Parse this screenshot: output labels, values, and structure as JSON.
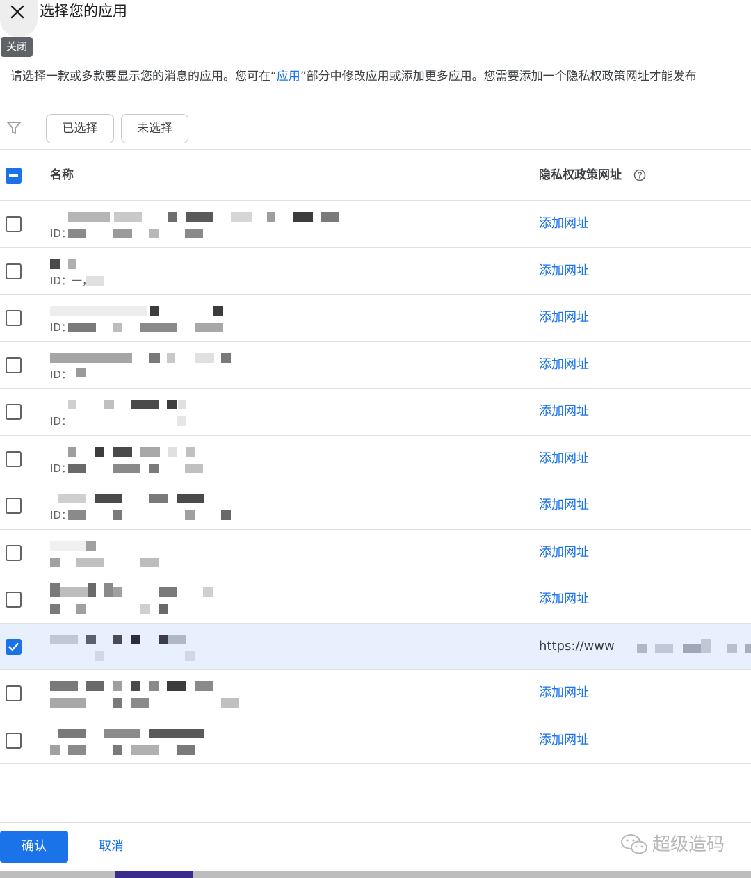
{
  "header": {
    "title": "选择您的应用",
    "close_tooltip": "关闭"
  },
  "description": {
    "before": "请选择一款或多款要显示您的消息的应用。您可在“",
    "link": "应用",
    "after": "”部分中修改应用或添加更多应用。您需要添加一个隐私权政策网址才能发布"
  },
  "filters": {
    "selected_label": "已选择",
    "unselected_label": "未选择"
  },
  "table": {
    "name_header": "名称",
    "privacy_header": "隐私权政策网址",
    "rows": [
      {
        "selected": false,
        "id_label": "ID：",
        "action": "添加网址"
      },
      {
        "selected": false,
        "id_label": "ID：一，",
        "action": "添加网址"
      },
      {
        "selected": false,
        "id_label": "ID：",
        "action": "添加网址"
      },
      {
        "selected": false,
        "id_label": "ID：",
        "action": "添加网址"
      },
      {
        "selected": false,
        "id_label": "ID：",
        "action": "添加网址"
      },
      {
        "selected": false,
        "id_label": "ID：",
        "action": "添加网址"
      },
      {
        "selected": false,
        "id_label": "ID：",
        "action": "添加网址"
      },
      {
        "selected": false,
        "id_label": "",
        "action": "添加网址"
      },
      {
        "selected": false,
        "id_label": "",
        "action": "添加网址"
      },
      {
        "selected": true,
        "id_label": "",
        "url": "https://www"
      },
      {
        "selected": false,
        "id_label": "",
        "action": "添加网址"
      },
      {
        "selected": false,
        "id_label": "",
        "action": "添加网址"
      }
    ]
  },
  "footer": {
    "confirm_label": "确认",
    "cancel_label": "取消"
  },
  "watermark": {
    "text": "超级造码"
  },
  "colors": {
    "accent": "#1a73e8",
    "selected_row": "#e8f0fe",
    "tooltip_bg": "#5f6368"
  },
  "icons": {
    "close": "close-icon",
    "filter": "filter-icon",
    "help": "help-icon",
    "check": "check-icon",
    "wechat": "wechat-icon"
  }
}
